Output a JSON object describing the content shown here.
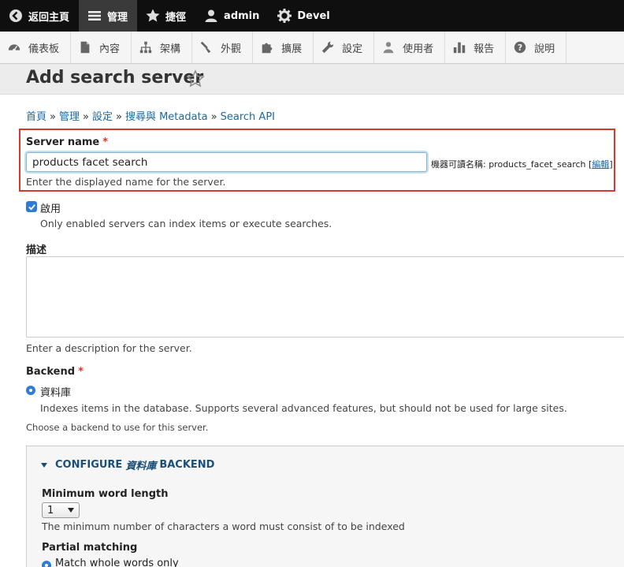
{
  "toolbar": {
    "back": "返回主頁",
    "manage": "管理",
    "shortcuts": "捷徑",
    "user": "admin",
    "devel": "Devel"
  },
  "tray": {
    "items": [
      "儀表板",
      "內容",
      "架構",
      "外觀",
      "擴展",
      "設定",
      "使用者",
      "報告",
      "說明"
    ]
  },
  "page": {
    "title": "Add search server"
  },
  "breadcrumb": {
    "items": [
      "首頁",
      "管理",
      "設定",
      "搜尋與 Metadata",
      "Search API"
    ],
    "separator": "»"
  },
  "form": {
    "server_name_label": "Server name",
    "required_mark": "*",
    "server_name_value": "products facet search",
    "machine_name_prefix": "機器可讀名稱: products_facet_search [",
    "machine_name_edit": "編輯",
    "machine_name_suffix": "]",
    "server_name_desc": "Enter the displayed name for the server.",
    "enabled_label": "啟用",
    "enabled_desc": "Only enabled servers can index items or execute searches.",
    "description_label": "描述",
    "description_desc": "Enter a description for the server.",
    "backend_label": "Backend",
    "backend_option": "資料庫",
    "backend_option_desc": "Indexes items in the database. Supports several advanced features, but should not be used for large sites.",
    "backend_desc": "Choose a backend to use for this server.",
    "configure_prefix": "CONFIGURE",
    "configure_backend_name": "資料庫",
    "configure_suffix": "BACKEND",
    "min_word_length_label": "Minimum word length",
    "min_word_length_value": "1",
    "min_word_length_desc": "The minimum number of characters a word must consist of to be indexed",
    "partial_matching_label": "Partial matching",
    "partial_matching_option": "Match whole words only"
  },
  "colors": {
    "accent": "#2f7bd6",
    "link": "#1a6aa5",
    "highlight": "#d63a2e"
  }
}
